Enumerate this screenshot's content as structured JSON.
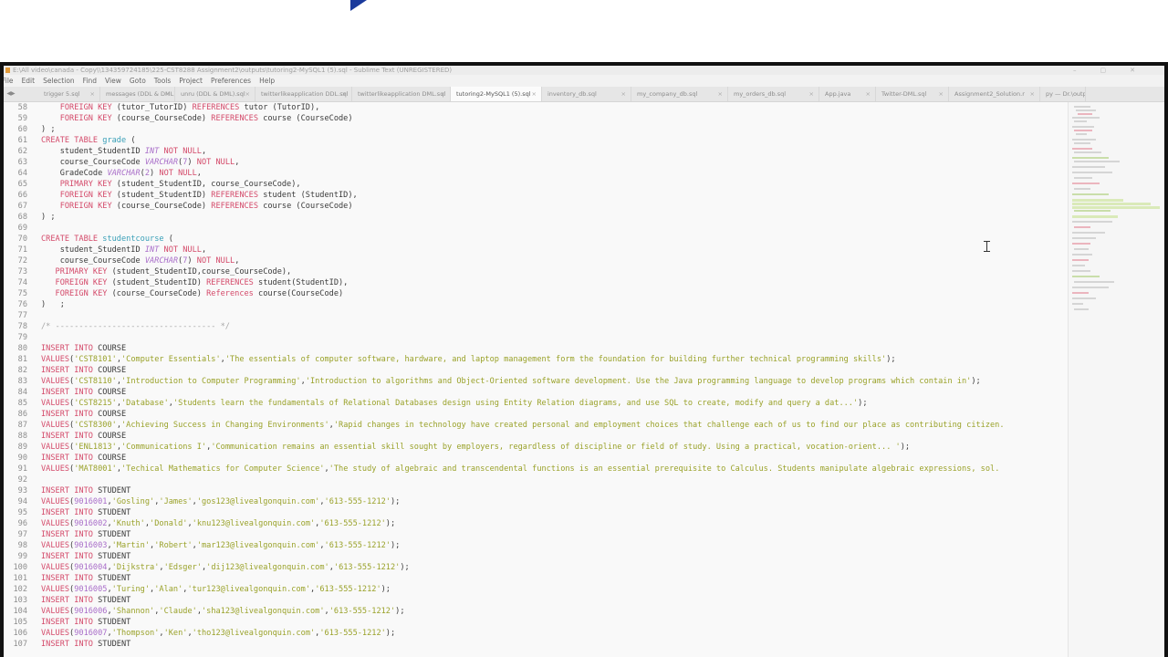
{
  "window": {
    "title": "E:\\All video\\canada - Copy\\\\134359724185\\225-CST8288 Assignment2\\outputs\\tutoring2-MySQL1 (5).sql - Sublime Text (UNREGISTERED)"
  },
  "menu": [
    "File",
    "Edit",
    "Selection",
    "Find",
    "View",
    "Goto",
    "Tools",
    "Project",
    "Preferences",
    "Help"
  ],
  "tabs": [
    {
      "label": "trigger 5.sql"
    },
    {
      "label": "messages (DDL & DML).sql"
    },
    {
      "label": "unru (DDL & DML).sql"
    },
    {
      "label": "twitterlikeapplication DDL.sql"
    },
    {
      "label": "twitterlikeapplication DML.sql"
    },
    {
      "label": "tutoring2-MySQL1 (5).sql",
      "active": true
    },
    {
      "label": "inventory_db.sql"
    },
    {
      "label": "my_company_db.sql"
    },
    {
      "label": "my_orders_db.sql"
    },
    {
      "label": "App.java"
    },
    {
      "label": "Twitter-DML.sql"
    },
    {
      "label": "Assignment2_Solution.r"
    },
    {
      "label": "py — Dr.\\output"
    }
  ],
  "code_lines": [
    {
      "n": "58",
      "t": "    FOREIGN KEY (tutor_TutorID) REFERENCES tutor (TutorID),"
    },
    {
      "n": "59",
      "t": "    FOREIGN KEY (course_CourseCode) REFERENCES course (CourseCode)"
    },
    {
      "n": "60",
      "t": ") ;"
    },
    {
      "n": "61",
      "t": "CREATE TABLE grade ("
    },
    {
      "n": "62",
      "t": "    student_StudentID INT NOT NULL,"
    },
    {
      "n": "63",
      "t": "    course_CourseCode VARCHAR(7) NOT NULL,"
    },
    {
      "n": "64",
      "t": "    GradeCode VARCHAR(2) NOT NULL,"
    },
    {
      "n": "65",
      "t": "    PRIMARY KEY (student_StudentID, course_CourseCode),"
    },
    {
      "n": "66",
      "t": "    FOREIGN KEY (student_StudentID) REFERENCES student (StudentID),"
    },
    {
      "n": "67",
      "t": "    FOREIGN KEY (course_CourseCode) REFERENCES course (CourseCode)"
    },
    {
      "n": "68",
      "t": ") ;"
    },
    {
      "n": "69",
      "t": ""
    },
    {
      "n": "70",
      "t": "CREATE TABLE studentcourse ("
    },
    {
      "n": "71",
      "t": "    student_StudentID INT NOT NULL,"
    },
    {
      "n": "72",
      "t": "    course_CourseCode VARCHAR(7) NOT NULL,"
    },
    {
      "n": "73",
      "t": "   PRIMARY KEY (student_StudentID,course_CourseCode),"
    },
    {
      "n": "74",
      "t": "   FOREIGN KEY (student_StudentID) REFERENCES student(StudentID),"
    },
    {
      "n": "75",
      "t": "   FOREIGN KEY (course_CourseCode) References course(CourseCode)"
    },
    {
      "n": "76",
      "t": ")   ;"
    },
    {
      "n": "77",
      "t": ""
    },
    {
      "n": "78",
      "t": "/* ---------------------------------- */"
    },
    {
      "n": "79",
      "t": ""
    },
    {
      "n": "80",
      "t": "INSERT INTO COURSE"
    },
    {
      "n": "81",
      "t": "VALUES('CST8101','Computer Essentials','The essentials of computer software, hardware, and laptop management form the foundation for building further technical programming skills');"
    },
    {
      "n": "82",
      "t": "INSERT INTO COURSE"
    },
    {
      "n": "83",
      "t": "VALUES('CST8110','Introduction to Computer Programming','Introduction to algorithms and Object-Oriented software development. Use the Java programming language to develop programs which contain in');"
    },
    {
      "n": "84",
      "t": "INSERT INTO COURSE"
    },
    {
      "n": "85",
      "t": "VALUES('CST8215','Database','Students learn the fundamentals of Relational Databases design using Entity Relation diagrams, and use SQL to create, modify and query a dat...');"
    },
    {
      "n": "86",
      "t": "INSERT INTO COURSE"
    },
    {
      "n": "87",
      "t": "VALUES('CST8300','Achieving Success in Changing Environments','Rapid changes in technology have created personal and employment choices that challenge each of us to find our place as contributing citizen."
    },
    {
      "n": "88",
      "t": "INSERT INTO COURSE"
    },
    {
      "n": "89",
      "t": "VALUES('ENL1813','Communications I','Communication remains an essential skill sought by employers, regardless of discipline or field of study. Using a practical, vocation-orient... ');"
    },
    {
      "n": "90",
      "t": "INSERT INTO COURSE"
    },
    {
      "n": "91",
      "t": "VALUES('MAT8001','Techical Mathematics for Computer Science','The study of algebraic and transcendental functions is an essential prerequisite to Calculus. Students manipulate algebraic expressions, sol."
    },
    {
      "n": "92",
      "t": ""
    },
    {
      "n": "93",
      "t": "INSERT INTO STUDENT"
    },
    {
      "n": "94",
      "t": "VALUES(9016001,'Gosling','James','gos123@livealgonquin.com','613-555-1212');"
    },
    {
      "n": "95",
      "t": "INSERT INTO STUDENT"
    },
    {
      "n": "96",
      "t": "VALUES(9016002,'Knuth','Donald','knu123@livealgonquin.com','613-555-1212');"
    },
    {
      "n": "97",
      "t": "INSERT INTO STUDENT"
    },
    {
      "n": "98",
      "t": "VALUES(9016003,'Martin','Robert','mar123@livealgonquin.com','613-555-1212');"
    },
    {
      "n": "99",
      "t": "INSERT INTO STUDENT"
    },
    {
      "n": "100",
      "t": "VALUES(9016004,'Dijkstra','Edsger','dij123@livealgonquin.com','613-555-1212');"
    },
    {
      "n": "101",
      "t": "INSERT INTO STUDENT"
    },
    {
      "n": "102",
      "t": "VALUES(9016005,'Turing','Alan','tur123@livealgonquin.com','613-555-1212');"
    },
    {
      "n": "103",
      "t": "INSERT INTO STUDENT"
    },
    {
      "n": "104",
      "t": "VALUES(9016006,'Shannon','Claude','sha123@livealgonquin.com','613-555-1212');"
    },
    {
      "n": "105",
      "t": "INSERT INTO STUDENT"
    },
    {
      "n": "106",
      "t": "VALUES(9016007,'Thompson','Ken','tho123@livealgonquin.com','613-555-1212');"
    },
    {
      "n": "107",
      "t": "INSERT INTO STUDENT"
    }
  ],
  "colors": {
    "keyword": "#d44a6a",
    "type": "#a96ec9",
    "name": "#3aa0b8",
    "string": "#9aa22a",
    "comment": "#a8a8a8"
  }
}
